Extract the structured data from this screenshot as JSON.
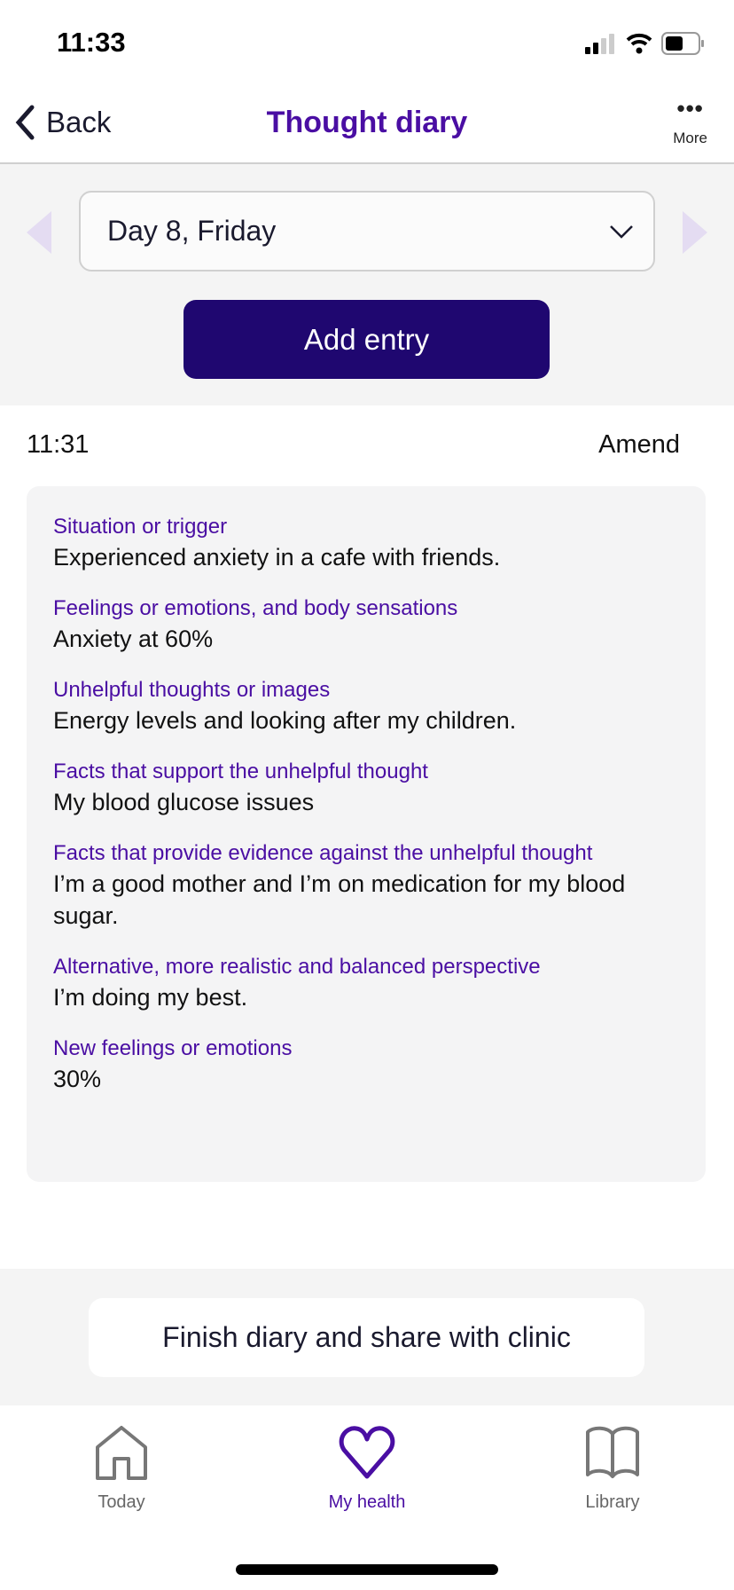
{
  "status_bar": {
    "time": "11:33"
  },
  "header": {
    "back_label": "Back",
    "title": "Thought diary",
    "more_label": "More"
  },
  "day_selector": {
    "value": "Day 8, Friday"
  },
  "add_entry_label": "Add entry",
  "entry": {
    "time": "11:31",
    "amend_label": "Amend",
    "fields": [
      {
        "label": "Situation or trigger",
        "value": "Experienced anxiety in a cafe with friends."
      },
      {
        "label": "Feelings or emotions, and body sensations",
        "value": "Anxiety at 60%"
      },
      {
        "label": "Unhelpful thoughts or images",
        "value": "Energy levels and looking after my children."
      },
      {
        "label": "Facts that support the unhelpful thought",
        "value": "My blood glucose issues"
      },
      {
        "label": "Facts that provide evidence against the unhelpful thought",
        "value": "I’m a good mother and I’m on medication for my blood sugar."
      },
      {
        "label": "Alternative, more realistic and balanced perspective",
        "value": "I’m doing my best."
      },
      {
        "label": "New feelings or emotions",
        "value": "30%"
      }
    ]
  },
  "finish_label": "Finish diary and share with clinic",
  "tabs": [
    {
      "label": "Today",
      "icon": "home-icon"
    },
    {
      "label": "My health",
      "icon": "heart-icon",
      "active": true
    },
    {
      "label": "Library",
      "icon": "book-icon"
    }
  ],
  "colors": {
    "accent": "#4a0ea3",
    "button": "#1f0770",
    "background_band": "#f4f4f4"
  }
}
